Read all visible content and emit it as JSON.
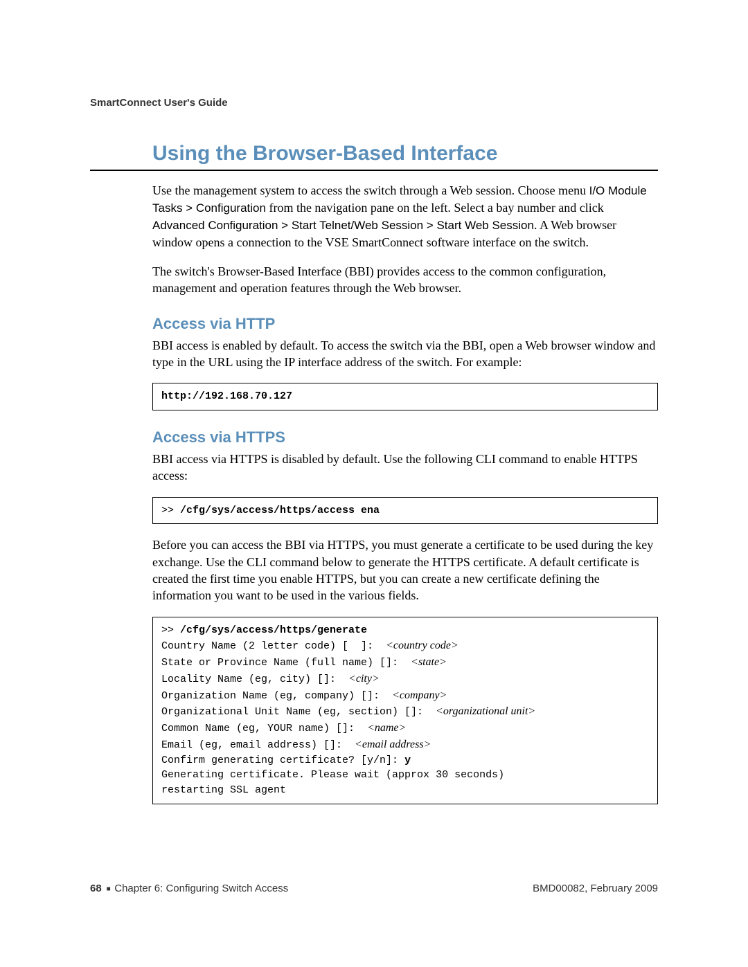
{
  "header": {
    "doc_title": "SmartConnect User's Guide"
  },
  "title": "Using the Browser-Based Interface",
  "intro": {
    "p1_a": "Use the management system to access the switch through a Web session. Choose menu ",
    "p1_b": "I/O Module Tasks > Configuration",
    "p1_c": " from the navigation pane on the left. Select a bay number and click ",
    "p1_d": "Advanced Configuration > Start Telnet/Web Session > Start Web Session",
    "p1_e": ". A Web browser window opens a connection to the VSE SmartConnect software interface on the switch.",
    "p2": "The switch's Browser-Based Interface (BBI) provides access to the common configuration, management and operation features through the Web browser."
  },
  "http": {
    "heading": "Access via HTTP",
    "p1": "BBI access is enabled by default. To access the switch via the BBI, open a Web browser window and type in the URL using the IP interface address of the switch. For example:",
    "code": "http://192.168.70.127"
  },
  "https": {
    "heading": "Access via HTTPS",
    "p1": "BBI access via HTTPS is disabled by default. Use the following CLI command to enable HTTPS access:",
    "code1_prompt": ">> ",
    "code1_cmd": "/cfg/sys/access/https/access ena",
    "p2": "Before you can access the BBI via HTTPS, you must generate a certificate to be used during the key exchange. Use the CLI command below to generate the HTTPS certificate. A default certificate is created the first time you enable HTTPS, but you can create a new certificate defining the information you want to be used in the various fields.",
    "gen": {
      "prompt": ">> ",
      "cmd": "/cfg/sys/access/https/generate",
      "l1a": "Country Name (2 letter code) [  ]:  ",
      "l1i": "<country code>",
      "l2a": "State or Province Name (full name) []:  ",
      "l2i": "<state>",
      "l3a": "Locality Name (eg, city) []:  ",
      "l3i": "<city>",
      "l4a": "Organization Name (eg, company) []:  ",
      "l4i": "<company>",
      "l5a": "Organizational Unit Name (eg, section) []:  ",
      "l5i": "<organizational unit>",
      "l6a": "Common Name (eg, YOUR name) []:  ",
      "l6i": "<name>",
      "l7a": "Email (eg, email address) []:  ",
      "l7i": "<email address>",
      "l8a": "Confirm generating certificate? [y/n]: ",
      "l8b": "y",
      "l9": "Generating certificate. Please wait (approx 30 seconds)",
      "l10": "restarting SSL agent"
    }
  },
  "footer": {
    "page_num": "68",
    "chapter": "Chapter 6: Configuring Switch Access",
    "docref": "BMD00082, February 2009"
  }
}
